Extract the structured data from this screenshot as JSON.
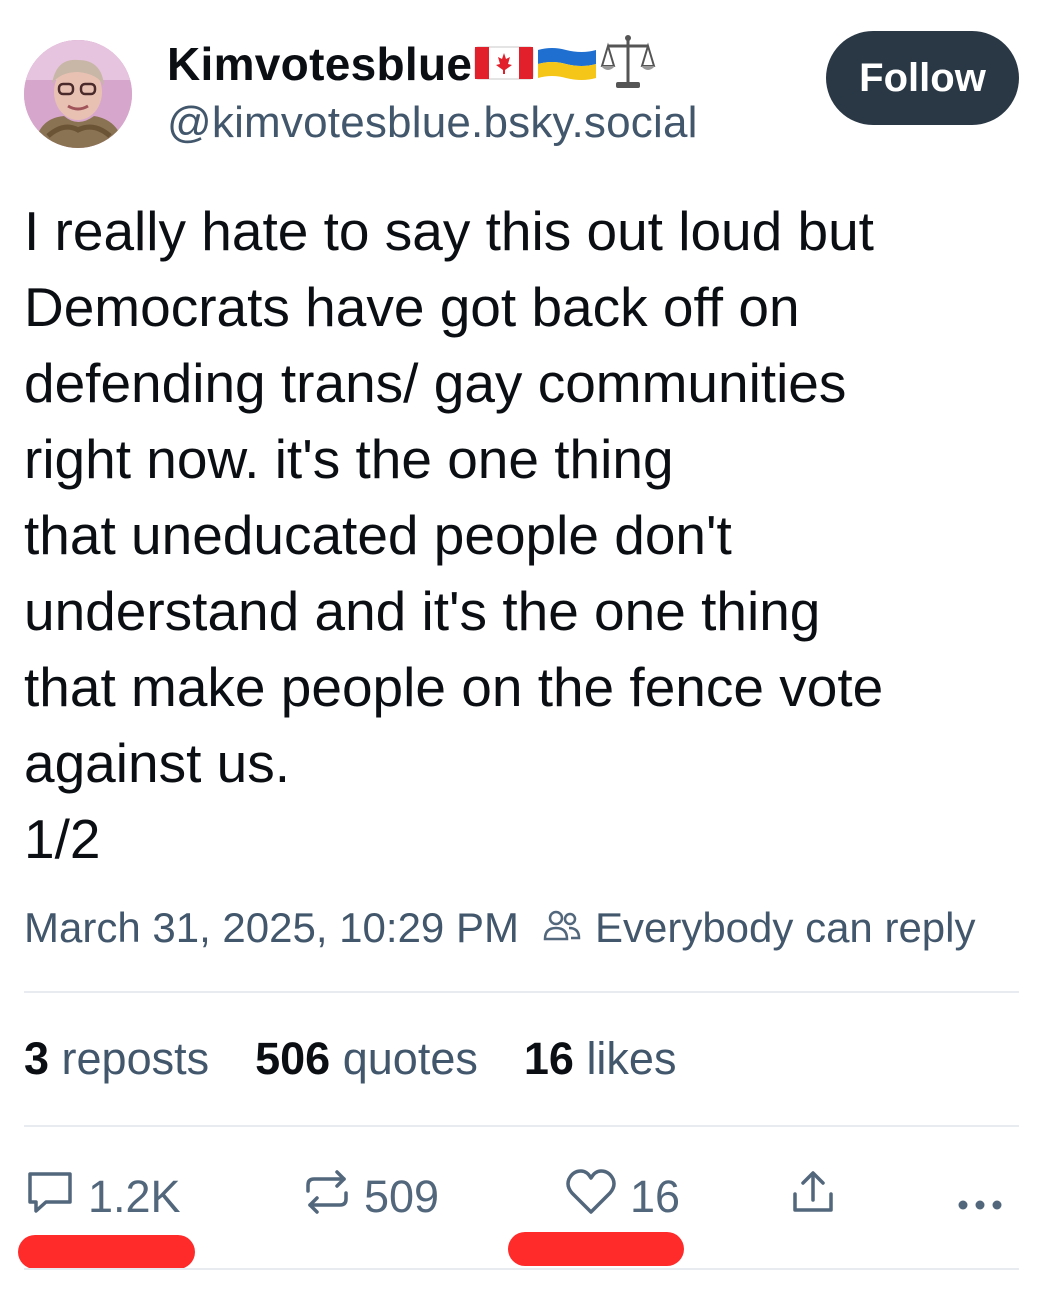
{
  "author": {
    "display_name": "Kimvotesblue",
    "handle": "@kimvotesblue.bsky.social",
    "avatar_icon": "profile-photo"
  },
  "follow_label": "Follow",
  "post": {
    "lines": [
      "I really hate to say this out loud but",
      "Democrats have got back off on",
      "defending trans/ gay communities",
      "right now. it's the one thing",
      "that uneducated people don't",
      "understand and it's the one thing",
      "that make people on the fence vote",
      "against us.",
      "1/2"
    ]
  },
  "meta": {
    "timestamp": "March 31, 2025, 10:29 PM",
    "reply_setting": "Everybody can reply"
  },
  "stats": {
    "reposts_count": "3",
    "reposts_label": "reposts",
    "quotes_count": "506",
    "quotes_label": "quotes",
    "likes_count": "16",
    "likes_label": "likes"
  },
  "actions": {
    "reply_count": "1.2K",
    "repost_count": "509",
    "like_count": "16"
  },
  "colors": {
    "text": "#0b0f14",
    "muted": "#42576c",
    "follow_bg": "#2a3845",
    "divider": "#e8ecf0",
    "highlight": "#ff2b2b"
  }
}
